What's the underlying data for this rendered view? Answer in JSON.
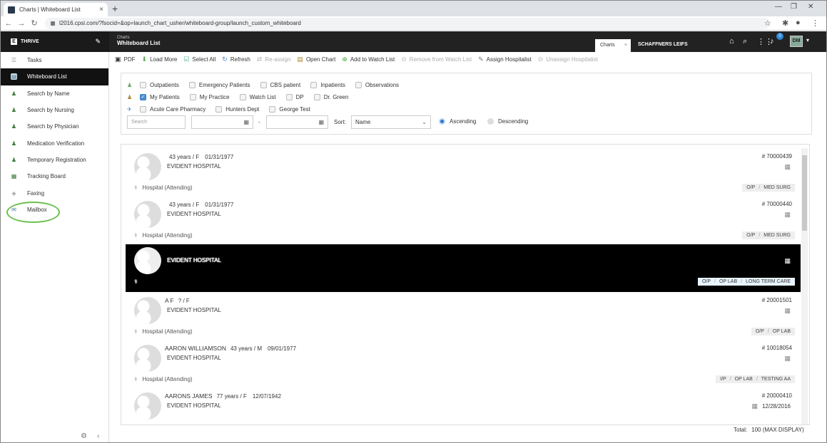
{
  "browser": {
    "tab_title": "Charts | Whiteboard List",
    "url": "l2016.cpsi.com/?fsocid=&op=launch_chart_usher/whiteboard-group/launch_custom_whiteboard"
  },
  "app": {
    "brand": "THRIVE",
    "crumb_small": "Charts",
    "crumb_title": "Whiteboard List",
    "open_tab": "Charts",
    "patient_name": "SCHAFFNERS LEIFS",
    "notification_count": "0",
    "user_initials": "DM",
    "accent": "#2d7bd0"
  },
  "sidebar": {
    "items": [
      {
        "label": "Tasks",
        "icon": "checklist-icon"
      },
      {
        "label": "Whiteboard List",
        "icon": "whiteboard-icon"
      },
      {
        "label": "Search by Name",
        "icon": "person-search-icon"
      },
      {
        "label": "Search by Nursing",
        "icon": "nurse-search-icon"
      },
      {
        "label": "Search by Physician",
        "icon": "physician-search-icon"
      },
      {
        "label": "Medication Verification",
        "icon": "medication-icon"
      },
      {
        "label": "Temporary Registration",
        "icon": "registration-icon"
      },
      {
        "label": "Tracking Board",
        "icon": "board-icon"
      },
      {
        "label": "Faxing",
        "icon": "fax-icon"
      },
      {
        "label": "Mailbox",
        "icon": "mail-icon"
      }
    ]
  },
  "toolbar": {
    "pdf": "PDF",
    "load_more": "Load More",
    "select_all": "Select All",
    "refresh": "Refresh",
    "reassign": "Re-assign",
    "open_chart": "Open Chart",
    "add_watch": "Add to Watch List",
    "remove_watch": "Remove from Watch List",
    "assign_hosp": "Assign Hospitalist",
    "unassign_hosp": "Unassign Hospitalist"
  },
  "filters": {
    "row1": [
      "Outpatients",
      "Emergency Patients",
      "CBS patient",
      "Inpatients",
      "Observations"
    ],
    "row2": [
      "My Patients",
      "My Practice",
      "Watch List",
      "DP",
      "Dr. Green"
    ],
    "row3": [
      "Acute Care Pharmacy",
      "Hunters Dept",
      "George Test"
    ],
    "search_placeholder": "Search",
    "date_sep": "-",
    "sort_label": "Sort:",
    "sort_value": "Name",
    "ascending": "Ascending",
    "descending": "Descending"
  },
  "patients": [
    {
      "name": "",
      "age_sex": "43 years / F",
      "dob": "01/31/1977",
      "hospital": "EVIDENT HOSPITAL",
      "id": "# 70000439",
      "date": "",
      "attending": "Hospital (Attending)",
      "tags": [
        "O/P",
        "MED SURG"
      ]
    },
    {
      "name": "",
      "age_sex": "43 years / F",
      "dob": "01/31/1977",
      "hospital": "EVIDENT HOSPITAL",
      "id": "# 70000440",
      "date": "",
      "attending": "Hospital (Attending)",
      "tags": [
        "O/P",
        "MED SURG"
      ]
    },
    {
      "name": "",
      "age_sex": "",
      "dob": "",
      "hospital": "EVIDENT HOSPITAL",
      "id": "",
      "date": "",
      "attending": "",
      "tags": [
        "O/P",
        "OP LAB",
        "LONG TERM CARE"
      ]
    },
    {
      "name": "A F",
      "age_sex": "? / F",
      "dob": "",
      "hospital": "EVIDENT HOSPITAL",
      "id": "# 20001501",
      "date": "",
      "attending": "Hospital (Attending)",
      "tags": [
        "O/P",
        "OP LAB"
      ]
    },
    {
      "name": "AARON WILLIAMSON",
      "age_sex": "43 years / M",
      "dob": "09/01/1977",
      "hospital": "EVIDENT HOSPITAL",
      "id": "# 10018054",
      "date": "",
      "attending": "Hospital (Attending)",
      "tags": [
        "I/P",
        "OP LAB",
        "TESTING AA"
      ]
    },
    {
      "name": "AARONS JAMES",
      "age_sex": "77 years / F",
      "dob": "12/07/1942",
      "hospital": "EVIDENT HOSPITAL",
      "id": "# 20000410",
      "date": "12/28/2016",
      "attending": "",
      "tags": []
    }
  ],
  "footer": {
    "total_label": "Total:",
    "total_value": "100 (MAX DISPLAY)"
  }
}
